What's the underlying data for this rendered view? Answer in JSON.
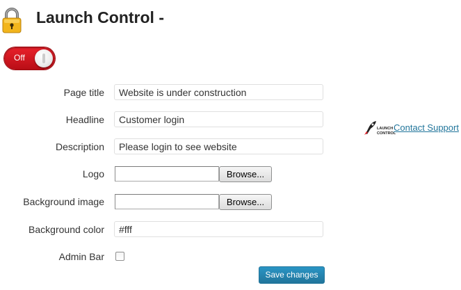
{
  "header": {
    "title": "Launch Control -",
    "icon": "lock-icon"
  },
  "toggle": {
    "label": "Off",
    "state": "off",
    "color": "#d71920"
  },
  "form": {
    "page_title": {
      "label": "Page title",
      "value": "Website is under construction"
    },
    "headline": {
      "label": "Headline",
      "value": "Customer login"
    },
    "description": {
      "label": "Description",
      "value": "Please login to see website"
    },
    "logo": {
      "label": "Logo",
      "button": "Browse..."
    },
    "background_image": {
      "label": "Background image",
      "button": "Browse..."
    },
    "background_color": {
      "label": "Background color",
      "value": "#fff"
    },
    "admin_bar": {
      "label": "Admin Bar",
      "checked": false
    },
    "save_button": "Save changes"
  },
  "support": {
    "logo_text": "LAUNCH CONTROL",
    "logo_icon": "rocket-icon",
    "link": "Contact Support",
    "link_color": "#21759b"
  },
  "colors": {
    "accent": "#21759b",
    "toggle_off": "#d71920"
  }
}
